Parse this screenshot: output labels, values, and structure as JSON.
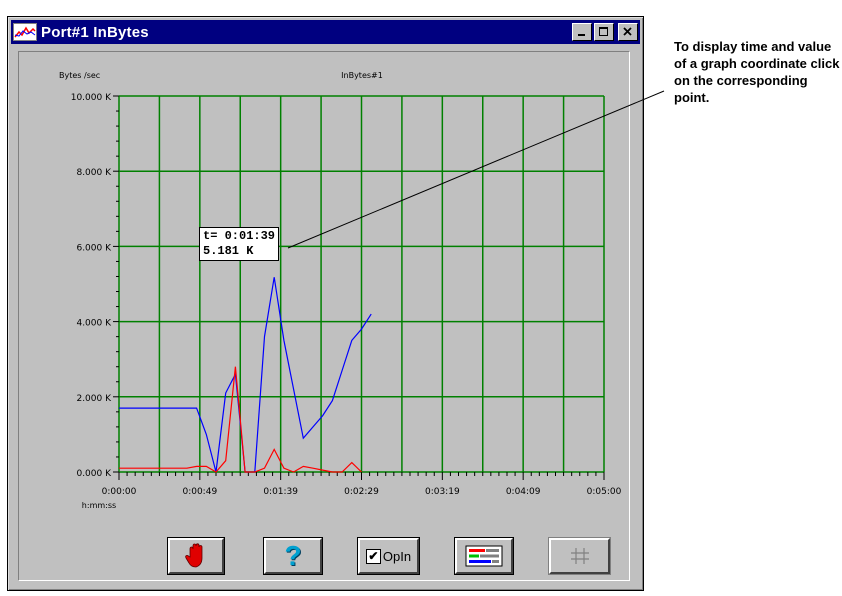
{
  "window": {
    "title": "Port#1 InBytes",
    "buttons": {
      "minimize": "minimize",
      "maximize": "maximize",
      "close": "close"
    }
  },
  "chart_data": {
    "type": "line",
    "title": "InBytes#1",
    "ylabel": "Bytes /sec",
    "xlabel": "h:mm:ss",
    "ylim": [
      0,
      10000
    ],
    "xlim_seconds": [
      0,
      300
    ],
    "y_ticks": [
      "0.000 K",
      "2.000 K",
      "4.000 K",
      "6.000 K",
      "8.000 K",
      "10.000 K"
    ],
    "x_ticks": [
      "0:00:00",
      "0:00:49",
      "0:01:39",
      "0:02:29",
      "0:03:19",
      "0:04:09",
      "0:05:00"
    ],
    "grid": true,
    "series": [
      {
        "color": "#0000ff",
        "x": [
          0,
          12,
          18,
          24,
          30,
          36,
          42,
          48,
          54,
          60,
          66,
          72,
          78,
          84,
          90,
          96,
          102,
          108,
          114,
          120,
          126,
          132,
          138,
          144,
          150,
          156
        ],
        "y": [
          1700,
          1700,
          1700,
          1700,
          1700,
          1700,
          1700,
          1700,
          1000,
          0,
          2100,
          2600,
          0,
          0,
          3600,
          5181,
          3500,
          2200,
          900,
          1200,
          1500,
          1900,
          2700,
          3500,
          3800,
          4200
        ]
      },
      {
        "color": "#ff0000",
        "x": [
          0,
          12,
          18,
          24,
          30,
          36,
          42,
          48,
          54,
          60,
          66,
          72,
          78,
          84,
          90,
          96,
          102,
          108,
          114,
          120,
          126,
          132,
          138,
          144,
          150
        ],
        "y": [
          100,
          100,
          100,
          100,
          100,
          100,
          100,
          150,
          150,
          0,
          300,
          2800,
          0,
          0,
          100,
          600,
          100,
          0,
          150,
          100,
          50,
          0,
          0,
          250,
          0
        ]
      }
    ]
  },
  "tooltip": {
    "time": "t= 0:01:39",
    "value": "5.181 K"
  },
  "toolbar": {
    "stop_icon": "hand-stop-icon",
    "help_label": "?",
    "opln_label": "OpIn",
    "legend_icon": "legend-bars-icon",
    "grid_icon": "grid-icon"
  },
  "callout": {
    "text": "To display time and value of a graph coordinate click on the corresponding point."
  },
  "colors": {
    "grid": "#008000",
    "plot_bg": "#c0c0c0",
    "title_bar": "#000080"
  }
}
